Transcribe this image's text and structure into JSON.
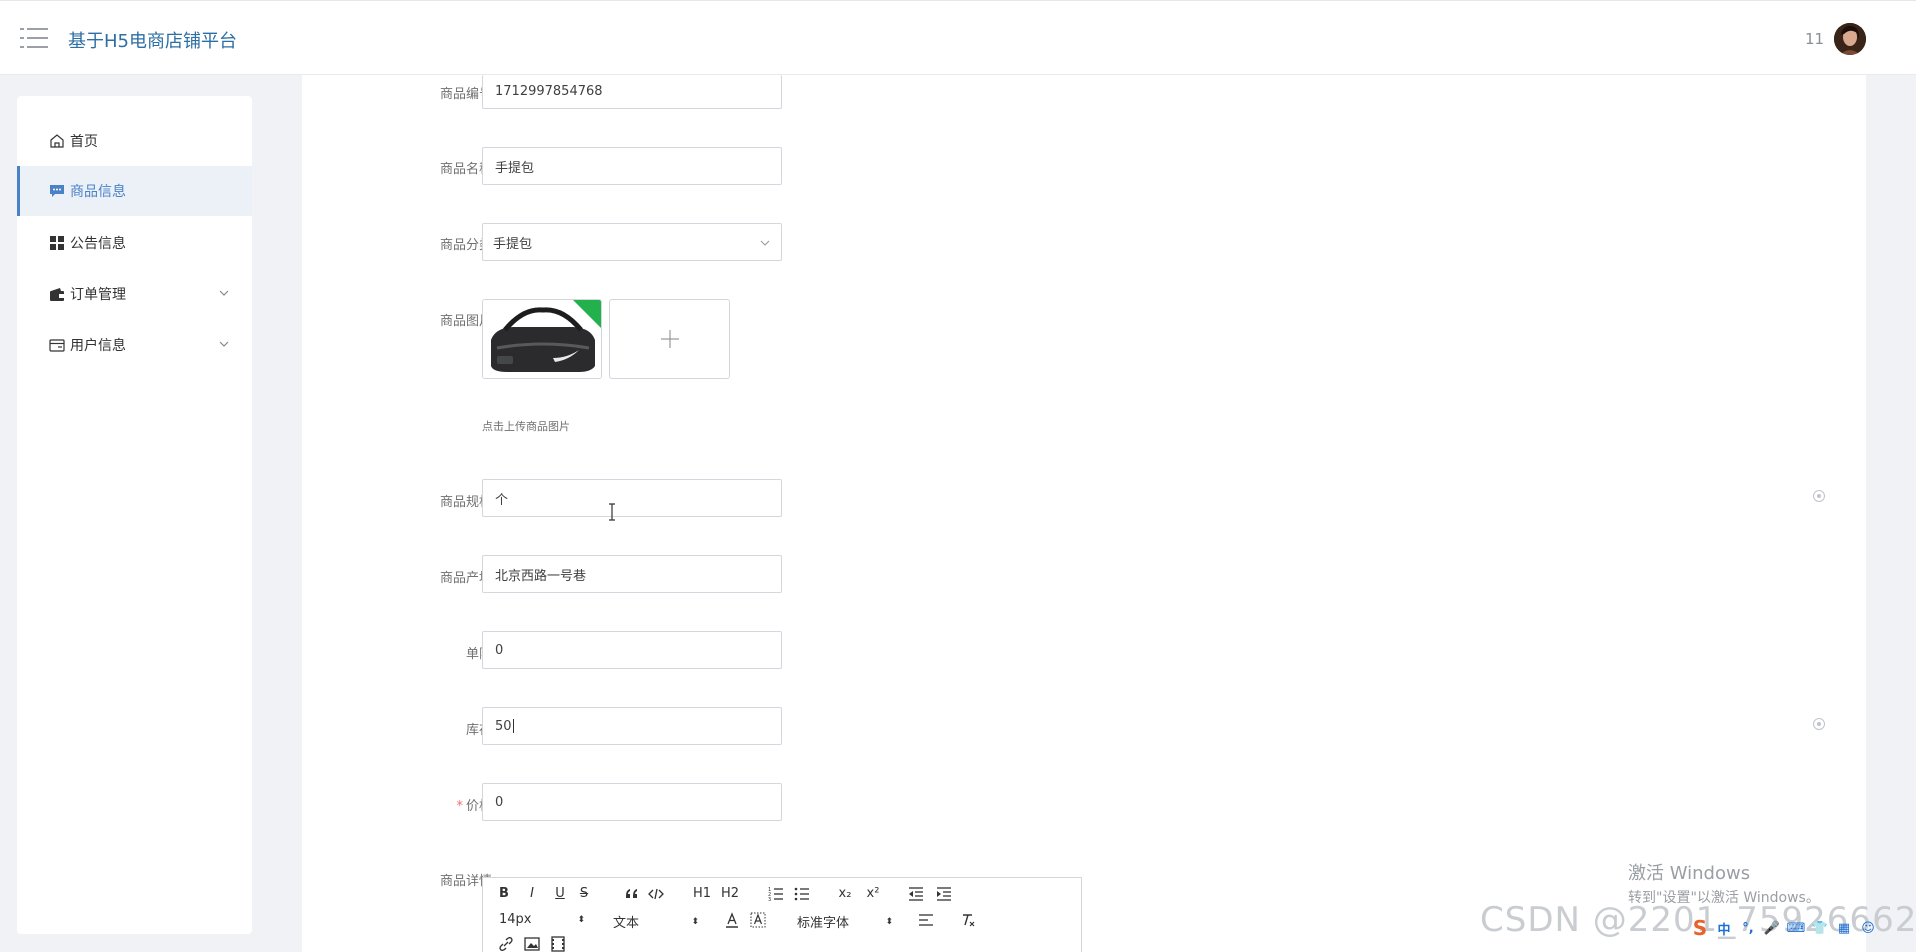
{
  "header": {
    "title": "基于H5电商店铺平台",
    "user_name": "11"
  },
  "sidebar": {
    "items": [
      {
        "label": "首页",
        "icon": "home-icon"
      },
      {
        "label": "商品信息",
        "icon": "chat-icon",
        "active": true
      },
      {
        "label": "公告信息",
        "icon": "grid-icon"
      },
      {
        "label": "订单管理",
        "icon": "wallet-icon",
        "expandable": true
      },
      {
        "label": "用户信息",
        "icon": "card-icon",
        "expandable": true
      }
    ]
  },
  "form": {
    "code": {
      "label": "商品编号",
      "value": "1712997854768"
    },
    "name": {
      "label": "商品名称",
      "value": "手提包"
    },
    "category": {
      "label": "商品分类",
      "value": "手提包"
    },
    "image": {
      "label": "商品图片",
      "tip": "点击上传商品图片"
    },
    "spec": {
      "label": "商品规格",
      "value": "个"
    },
    "origin": {
      "label": "商品产地",
      "value": "北京西路一号巷"
    },
    "limit": {
      "label": "单限",
      "value": "0"
    },
    "stock": {
      "label": "库存",
      "value": "50"
    },
    "price": {
      "label": "价格",
      "required_mark": "*",
      "value": "0"
    },
    "detail": {
      "label": "商品详情"
    }
  },
  "editor": {
    "buttons": [
      "B",
      "I",
      "U",
      "S"
    ],
    "heading1": "H1",
    "heading2": "H2",
    "sub": "x₂",
    "sup": "x²",
    "font_size": "14px",
    "text_type": "文本",
    "font_family": "标准字体"
  },
  "watermark": {
    "windows_title": "激活 Windows",
    "windows_sub": "转到\"设置\"以激活 Windows。",
    "csdn": "CSDN @2201_75926662"
  },
  "tray": {
    "ime": "中"
  }
}
